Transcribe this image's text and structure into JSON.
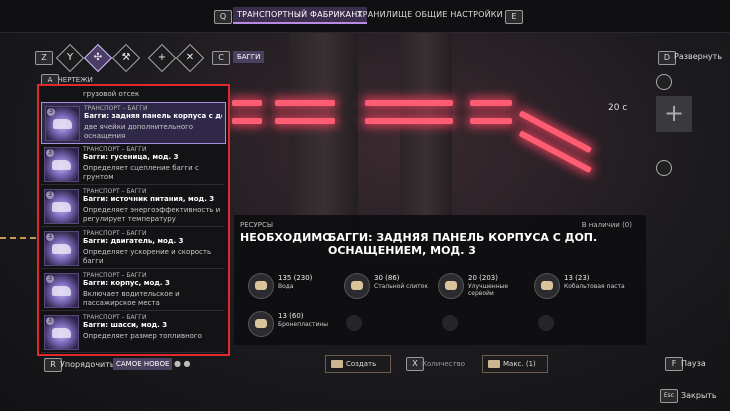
{
  "topbar": {
    "left_key": "Q",
    "right_key": "E",
    "tabs": [
      {
        "label": "ТРАНСПОРТНЫЙ ФАБРИКАНТ"
      },
      {
        "label": "ХРАНИЛИЩЕ"
      },
      {
        "label": "ОБЩИЕ НАСТРОЙКИ"
      }
    ]
  },
  "category_bar": {
    "left_key": "Z",
    "right_key": "C",
    "icons": [
      "y-shape-icon",
      "beetle-icon",
      "wrench-icon",
      "scissors-icon",
      "plus-icon",
      "crossed-tools-icon"
    ],
    "active_label": "БАГГИ"
  },
  "blueprints": {
    "key": "A",
    "title": "ЧЕРТЕЖИ",
    "top_cut_text": "грузовой отсек",
    "items": [
      {
        "count": "3",
        "category": "ТРАНСПОРТ – БАГГИ",
        "name": "Багги: задняя панель корпуса с доп. о",
        "desc": "две ячейки дополнительного оснащения"
      },
      {
        "count": "3",
        "category": "ТРАНСПОРТ – БАГГИ",
        "name": "Багги: гусеница, мод. 3",
        "desc": "Определяет сцепление багги с грунтом"
      },
      {
        "count": "3",
        "category": "ТРАНСПОРТ – БАГГИ",
        "name": "Багги: источник питания, мод. 3",
        "desc": "Определяет энергоэффективность и регулирует температуру"
      },
      {
        "count": "3",
        "category": "ТРАНСПОРТ – БАГГИ",
        "name": "Багги: двигатель, мод. 3",
        "desc": "Определяет ускорение и скорость багги"
      },
      {
        "count": "3",
        "category": "ТРАНСПОРТ – БАГГИ",
        "name": "Багги: корпус, мод. 3",
        "desc": "Включает водительское и пассажирское места"
      },
      {
        "count": "3",
        "category": "ТРАНСПОРТ – БАГГИ",
        "name": "Багги: шасси, мод. 3",
        "desc": "Определяет размер топливного"
      }
    ]
  },
  "sort": {
    "key": "R",
    "label": "Упорядочить",
    "value": "САМОЕ НОВОЕ"
  },
  "resources": {
    "section_label": "РЕСУРСЫ",
    "required_label": "НЕОБХОДИМО",
    "in_stock": "В наличии (0)",
    "item_title": "БАГГИ: ЗАДНЯЯ ПАНЕЛЬ КОРПУСА С ДОП. ОСНАЩЕНИЕМ, МОД. 3",
    "list": [
      {
        "qty": "135 (230)",
        "name": "Вода",
        "icon": "water-icon"
      },
      {
        "qty": "30 (86)",
        "name": "Стальной слиток",
        "icon": "steel-ingot-icon"
      },
      {
        "qty": "20 (203)",
        "name": "Улучшенные сервойи",
        "icon": "servo-icon"
      },
      {
        "qty": "13 (23)",
        "name": "Кобальтовая паста",
        "icon": "cobalt-paste-icon"
      },
      {
        "qty": "13 (60)",
        "name": "Бронепластины",
        "icon": "armor-plate-icon"
      }
    ]
  },
  "actions": {
    "create": "Создать",
    "qty_key": "X",
    "qty_label": "Количество",
    "max": "Макс. (1)"
  },
  "right": {
    "expand_key": "D",
    "expand_label": "Развернуть",
    "time": "20 с",
    "pause_key": "F",
    "pause_label": "Пауза",
    "close_label": "Закрыть",
    "close_key": "Esc"
  },
  "colors": {
    "accent": "#b88be0",
    "highlight": "#e0282d",
    "beam": "#ff5d74"
  }
}
